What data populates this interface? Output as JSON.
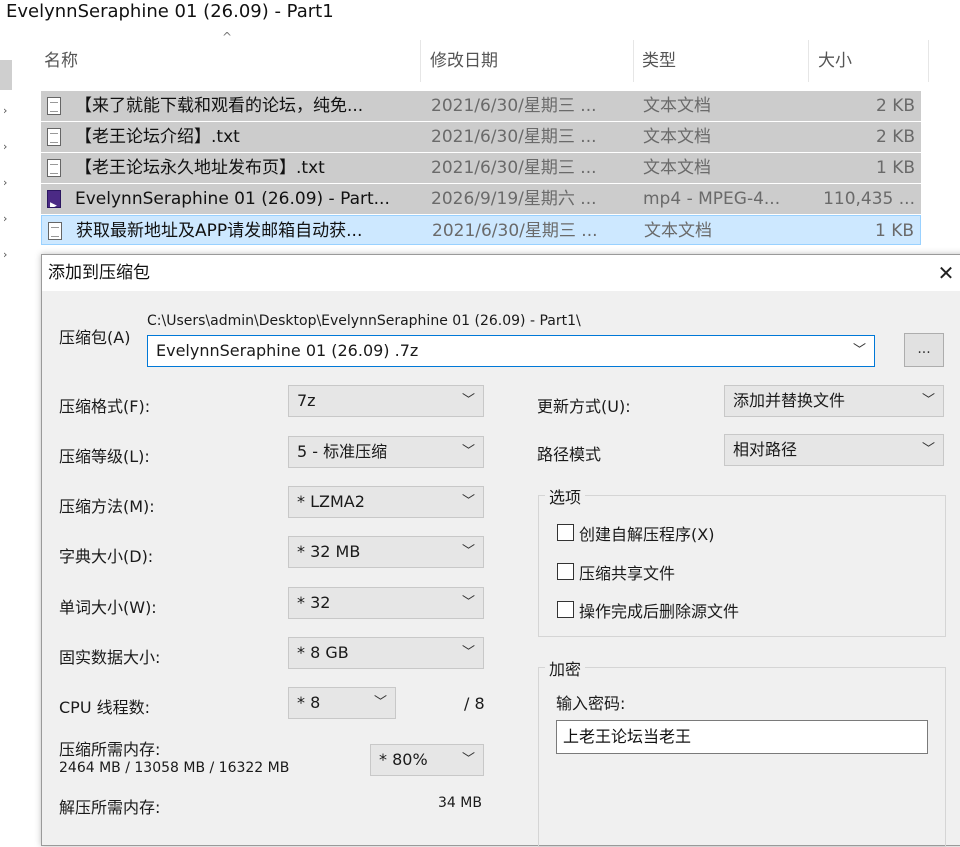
{
  "window": {
    "title": "EvelynnSeraphine 01 (26.09) - Part1"
  },
  "columns": {
    "name": "名称",
    "date": "修改日期",
    "type": "类型",
    "size": "大小",
    "sort_caret": "^"
  },
  "files": [
    {
      "name": "【来了就能下载和观看的论坛，纯免...",
      "date": "2021/6/30/星期三 ...",
      "type": "文本文档",
      "size": "2 KB",
      "icon": "text-file-icon"
    },
    {
      "name": "【老王论坛介绍】.txt",
      "date": "2021/6/30/星期三 ...",
      "type": "文本文档",
      "size": "2 KB",
      "icon": "text-file-icon"
    },
    {
      "name": "【老王论坛永久地址发布页】.txt",
      "date": "2021/6/30/星期三 ...",
      "type": "文本文档",
      "size": "1 KB",
      "icon": "text-file-icon"
    },
    {
      "name": "EvelynnSeraphine 01 (26.09) - Part...",
      "date": "2026/9/19/星期六 ...",
      "type": "mp4 - MPEG-4...",
      "size": "110,435 ...",
      "icon": "mp4-file-icon"
    },
    {
      "name": "获取最新地址及APP请发邮箱自动获...",
      "date": "2021/6/30/星期三 ...",
      "type": "文本文档",
      "size": "1 KB",
      "icon": "text-file-icon"
    }
  ],
  "dialog": {
    "title": "添加到压缩包",
    "close": "✕",
    "archive_label": "压缩包(A)",
    "archive_path": "C:\\Users\\admin\\Desktop\\EvelynnSeraphine 01 (26.09) - Part1\\",
    "archive_name": "EvelynnSeraphine 01 (26.09) .7z",
    "browse": "...",
    "format_label": "压缩格式(F):",
    "format_value": "7z",
    "level_label": "压缩等级(L):",
    "level_value": "5 - 标准压缩",
    "method_label": "压缩方法(M):",
    "method_value": "* LZMA2",
    "dict_label": "字典大小(D):",
    "dict_value": "* 32 MB",
    "word_label": "单词大小(W):",
    "word_value": "* 32",
    "solid_label": "固实数据大小:",
    "solid_value": "* 8 GB",
    "cpu_label": "CPU 线程数:",
    "cpu_value": "* 8",
    "cpu_max": "/ 8",
    "mem_label": "压缩所需内存:",
    "mem_detail": "2464 MB / 13058 MB / 16322 MB",
    "mem_value": "* 80%",
    "decomp_label": "解压所需内存:",
    "decomp_value": "34 MB",
    "update_label": "更新方式(U):",
    "update_value": "添加并替换文件",
    "path_label": "路径模式",
    "path_value": "相对路径",
    "options_title": "选项",
    "opt_sfx": "创建自解压程序(X)",
    "opt_shared": "压缩共享文件",
    "opt_delete": "操作完成后删除源文件",
    "encrypt_title": "加密",
    "password_label": "输入密码:",
    "password_value": "上老王论坛当老王",
    "chevron": "﹀"
  }
}
